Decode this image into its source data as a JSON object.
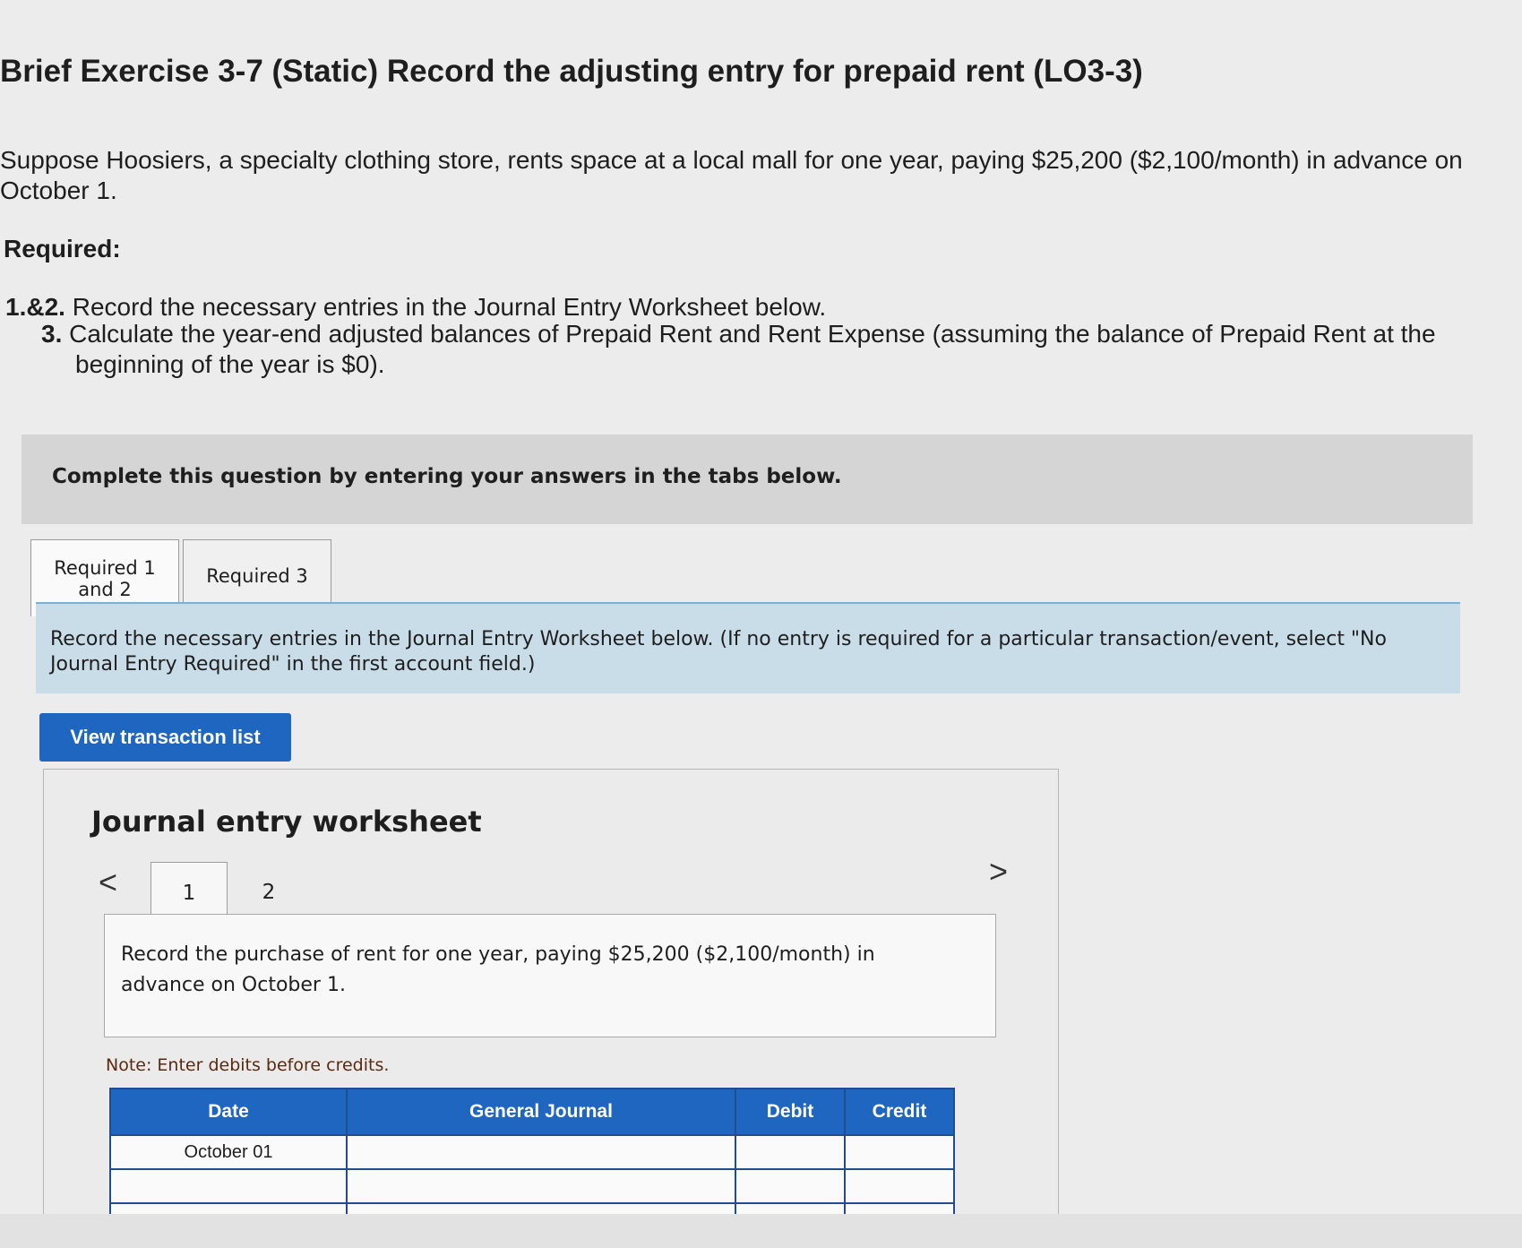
{
  "page_title": "Brief Exercise 3-7 (Static) Record the adjusting entry for prepaid rent (LO3-3)",
  "intro": "Suppose Hoosiers, a specialty clothing store, rents space at a local mall for one year, paying $25,200 ($2,100/month) in advance on October 1.",
  "required_label": "Required:",
  "requirements": [
    {
      "num": "1.&2.",
      "text": "Record the necessary entries in the Journal Entry Worksheet below."
    },
    {
      "num": "3.",
      "text": "Calculate the year-end adjusted balances of Prepaid Rent and Rent Expense (assuming the balance of Prepaid Rent at the beginning of the year is $0)."
    }
  ],
  "banner_text": "Complete this question by entering your answers in the tabs below.",
  "tabs": [
    {
      "line1": "Required 1",
      "line2": "and 2"
    },
    {
      "label": "Required 3"
    }
  ],
  "instruction": "Record the necessary entries in the Journal Entry Worksheet below. (If no entry is required for a particular transaction/event, select \"No Journal Entry Required\" in the first account field.)",
  "view_button": "View transaction list",
  "worksheet": {
    "title": "Journal entry worksheet",
    "prev": "<",
    "next": ">",
    "pages": [
      "1",
      "2"
    ],
    "description": "Record the purchase of rent for one year, paying $25,200 ($2,100/month) in advance on October 1.",
    "note": "Note: Enter debits before credits.",
    "columns": [
      "Date",
      "General Journal",
      "Debit",
      "Credit"
    ],
    "rows": [
      {
        "date": "October 01",
        "account": "",
        "debit": "",
        "credit": ""
      },
      {
        "date": "",
        "account": "",
        "debit": "",
        "credit": ""
      },
      {
        "date": "",
        "account": "",
        "debit": "",
        "credit": ""
      }
    ]
  },
  "colors": {
    "accent": "#1f66c0",
    "instruction_bg": "#c9dde9",
    "banner_bg": "#d5d5d5"
  }
}
